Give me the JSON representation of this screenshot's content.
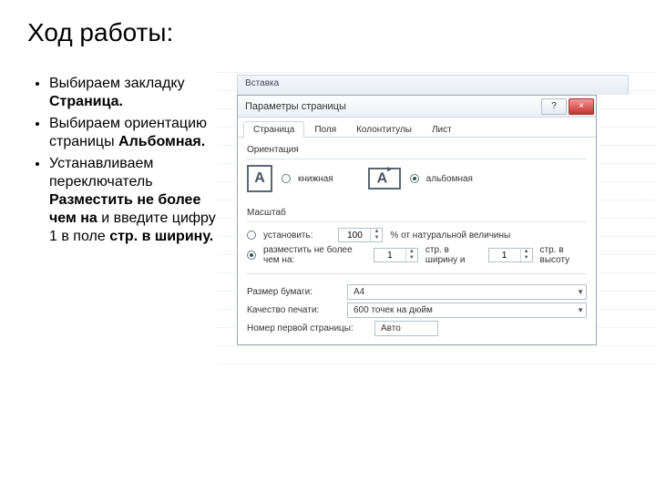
{
  "slide": {
    "title": "Ход работы:",
    "bullets": [
      {
        "pre": "Выбираем закладку ",
        "bold": "Страница.",
        "post": ""
      },
      {
        "pre": "Выбираем ориентацию страницы ",
        "bold": "Альбомная.",
        "post": ""
      },
      {
        "pre": "Устанавливаем переключатель ",
        "bold": "Разместить не более чем на",
        "post": " и введите цифру 1 в поле ",
        "bold2": "стр. в ширину."
      }
    ]
  },
  "ribbon": {
    "label": "Вставка"
  },
  "dialog": {
    "title": "Параметры страницы",
    "help": "?",
    "close": "×",
    "tabs": [
      "Страница",
      "Поля",
      "Колонтитулы",
      "Лист"
    ],
    "active_tab": 0,
    "orientation": {
      "group": "Ориентация",
      "portrait": "книжная",
      "landscape": "альбомная",
      "selected": "landscape"
    },
    "scale": {
      "group": "Масштаб",
      "set_label": "установить:",
      "set_value": "100",
      "set_suffix": "% от натуральной величины",
      "fit_label": "разместить не более чем на:",
      "fit_w": "1",
      "fit_w_suffix": "стр. в ширину и",
      "fit_h": "1",
      "fit_h_suffix": "стр. в высоту",
      "selected": "fit"
    },
    "paper": {
      "label": "Размер бумаги:",
      "value": "A4"
    },
    "quality": {
      "label": "Качество печати:",
      "value": "600 точек на дюйм"
    },
    "firstpage": {
      "label": "Номер первой страницы:",
      "value": "Авто"
    }
  }
}
